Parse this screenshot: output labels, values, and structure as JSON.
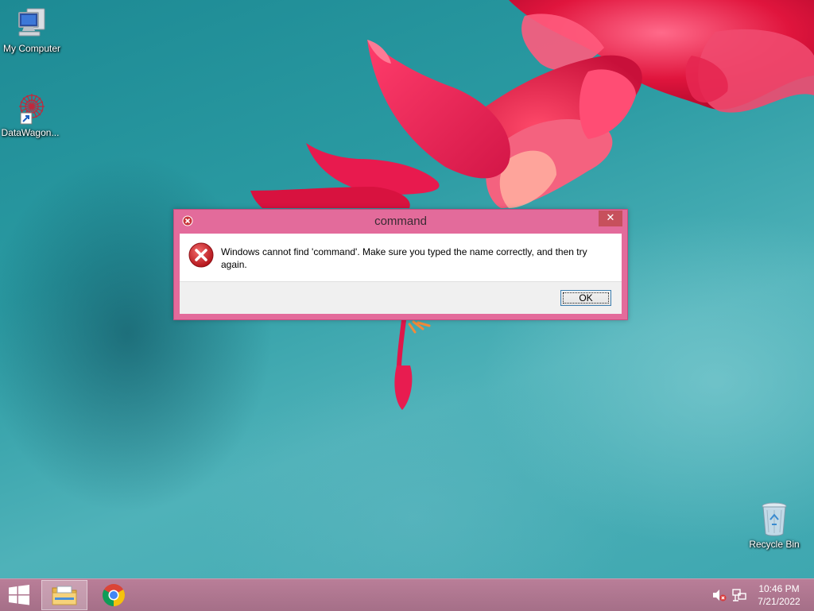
{
  "desktop": {
    "icons": [
      {
        "label": "My Computer"
      },
      {
        "label": "DataWagon..."
      },
      {
        "label": "Recycle Bin"
      }
    ]
  },
  "dialog": {
    "title": "command",
    "message": "Windows cannot find 'command'. Make sure you typed the name correctly, and then try again.",
    "ok_label": "OK",
    "close_glyph": "✕"
  },
  "taskbar": {
    "clock": {
      "time": "10:46 PM",
      "date": "7/21/2022"
    },
    "items": [
      {
        "icon": "windows-logo-icon"
      },
      {
        "icon": "file-explorer-icon"
      },
      {
        "icon": "chrome-icon"
      }
    ],
    "tray": [
      {
        "icon": "volume-muted-icon"
      },
      {
        "icon": "network-icon"
      }
    ]
  },
  "colors": {
    "dialog_frame": "#e36b9b",
    "close_button": "#c7505c",
    "taskbar": "#b07891",
    "desktop": "#2a9aa2"
  }
}
